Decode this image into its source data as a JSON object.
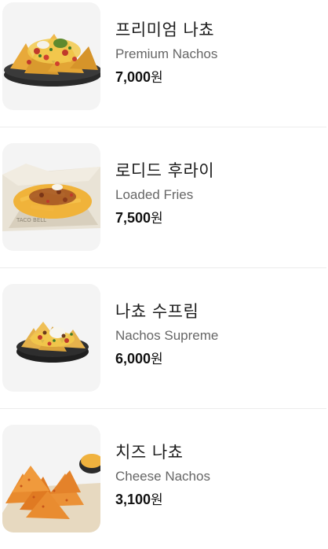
{
  "menu": {
    "items": [
      {
        "name_ko": "프리미엄 나쵸",
        "name_en": "Premium Nachos",
        "price": "7,000",
        "currency": "원",
        "image_icon": "premium-nachos-image"
      },
      {
        "name_ko": "로디드 후라이",
        "name_en": "Loaded Fries",
        "price": "7,500",
        "currency": "원",
        "image_icon": "loaded-fries-image"
      },
      {
        "name_ko": "나쵸 수프림",
        "name_en": "Nachos Supreme",
        "price": "6,000",
        "currency": "원",
        "image_icon": "nachos-supreme-image"
      },
      {
        "name_ko": "치즈 나쵸",
        "name_en": "Cheese Nachos",
        "price": "3,100",
        "currency": "원",
        "image_icon": "cheese-nachos-image"
      }
    ]
  },
  "colors": {
    "thumb_background": "#f4f4f4",
    "divider": "#ececec",
    "name_en": "#666666"
  }
}
